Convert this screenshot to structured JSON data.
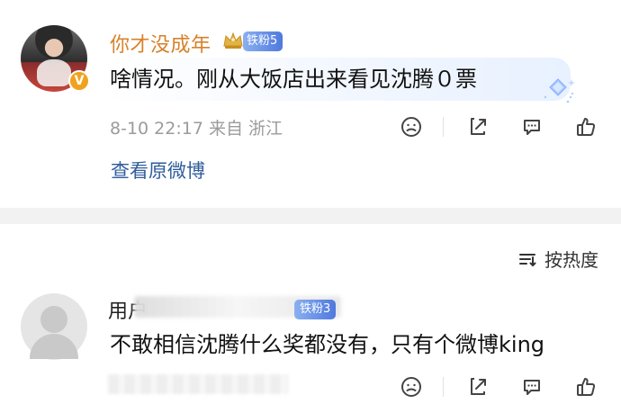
{
  "comments": [
    {
      "username": "你才没成年",
      "fan_badge": "铁粉5",
      "text": "啥情况。刚从大饭店出来看见沈腾０票",
      "meta": "8-10 22:17  来自 浙江",
      "view_original": "查看原微博"
    },
    {
      "username_prefix": "用户",
      "fan_badge": "铁粉3",
      "text": "不敢相信沈腾什么奖都没有，只有个微博king"
    }
  ],
  "sort": {
    "label": "按热度"
  },
  "icons": {
    "verified": "verified-badge-icon",
    "crown": "crown-icon",
    "diamond": "diamond-icon",
    "dislike": "dislike-face-icon",
    "share": "share-icon",
    "reply": "comment-icon",
    "like": "like-icon",
    "sort": "sort-icon"
  },
  "colors": {
    "username_highlight": "#d6822b",
    "link": "#2f5d9b",
    "badge_start": "#8ab0f0",
    "badge_end": "#4f79df",
    "meta": "#9b9b9b"
  }
}
